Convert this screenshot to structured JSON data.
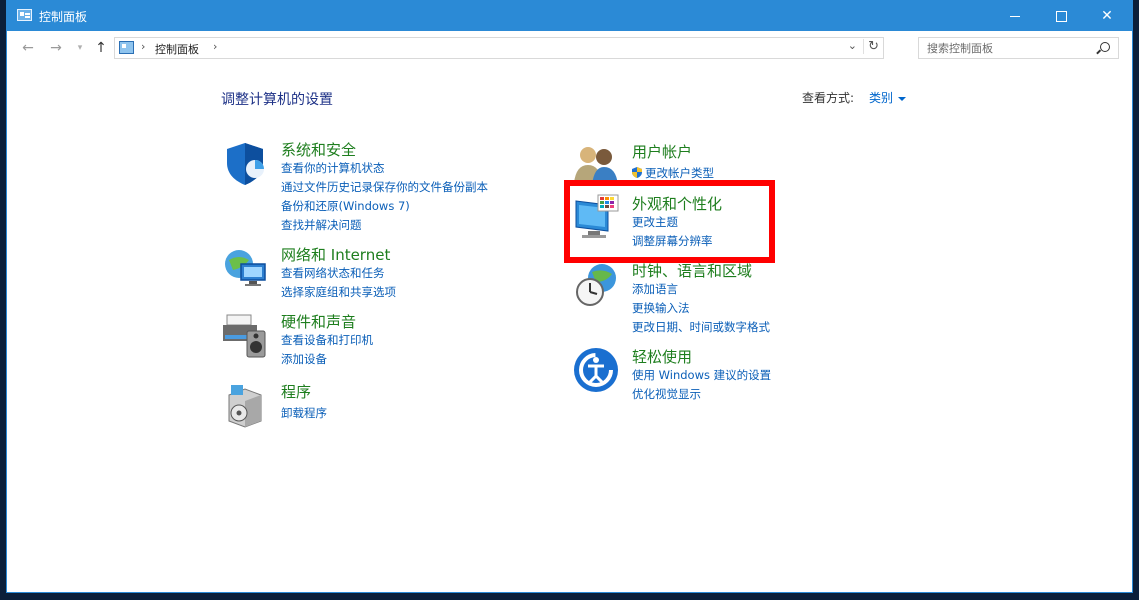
{
  "window": {
    "title": "控制面板"
  },
  "navbar": {
    "back": "←",
    "forward": "→",
    "recent": "▾",
    "up": "↑",
    "breadcrumb": "控制面板",
    "separator": "›",
    "dropdown": "⌄",
    "refresh": "↻",
    "search_placeholder": "搜索控制面板"
  },
  "content": {
    "title": "调整计算机的设置",
    "viewby_label": "查看方式:",
    "viewby_value": "类别",
    "categories": [
      {
        "name": "系统和安全",
        "icon": "shield-icon",
        "links": [
          "查看你的计算机状态",
          "通过文件历史记录保存你的文件备份副本",
          "备份和还原(Windows 7)",
          "查找并解决问题"
        ]
      },
      {
        "name": "网络和 Internet",
        "icon": "network-globe-icon",
        "links": [
          "查看网络状态和任务",
          "选择家庭组和共享选项"
        ]
      },
      {
        "name": "硬件和声音",
        "icon": "printer-speaker-icon",
        "links": [
          "查看设备和打印机",
          "添加设备"
        ]
      },
      {
        "name": "程序",
        "icon": "programs-box-icon",
        "links": [
          "卸载程序"
        ]
      },
      {
        "name": "用户帐户",
        "icon": "users-icon",
        "links": [
          "更改帐户类型"
        ]
      },
      {
        "name": "外观和个性化",
        "icon": "monitor-palette-icon",
        "links": [
          "更改主题",
          "调整屏幕分辨率"
        ]
      },
      {
        "name": "时钟、语言和区域",
        "icon": "clock-globe-icon",
        "links": [
          "添加语言",
          "更换输入法",
          "更改日期、时间或数字格式"
        ]
      },
      {
        "name": "轻松使用",
        "icon": "ease-of-access-icon",
        "links": [
          "使用 Windows 建议的设置",
          "优化视觉显示"
        ]
      }
    ]
  },
  "colors": {
    "titlebar": "#2b8ad6",
    "link": "#0b5fb8",
    "category": "#1e7e1e",
    "highlight": "#ff0000"
  }
}
